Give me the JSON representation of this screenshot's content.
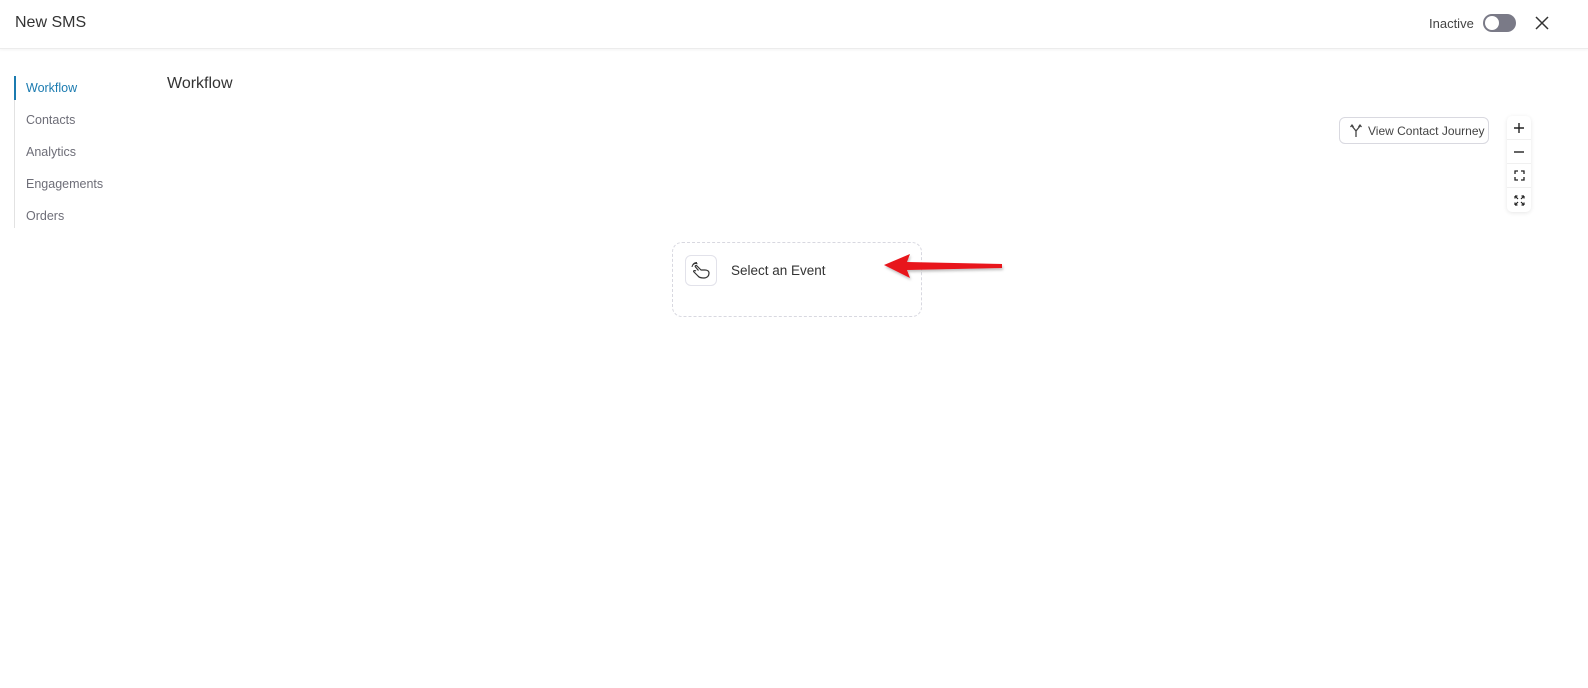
{
  "header": {
    "title": "New SMS",
    "status_label": "Inactive",
    "toggle_on": false,
    "toggle_color": "#7a7a87",
    "close_icon": "close-icon"
  },
  "sidebar": {
    "accent_color": "#1b7bb0",
    "items": [
      {
        "label": "Workflow",
        "active": true
      },
      {
        "label": "Contacts",
        "active": false
      },
      {
        "label": "Analytics",
        "active": false
      },
      {
        "label": "Engagements",
        "active": false
      },
      {
        "label": "Orders",
        "active": false
      }
    ]
  },
  "main": {
    "title": "Workflow",
    "journey_button": {
      "label": "View Contact Journey",
      "icon": "branch-icon"
    },
    "zoom_controls": [
      {
        "name": "zoom-in",
        "icon": "plus-icon"
      },
      {
        "name": "zoom-out",
        "icon": "minus-icon"
      },
      {
        "name": "fit-view",
        "icon": "fit-view-icon"
      },
      {
        "name": "fullscreen",
        "icon": "expand-icon"
      }
    ],
    "event_node": {
      "label": "Select an Event",
      "icon": "hand-pointer-icon"
    },
    "annotation": {
      "type": "arrow",
      "color": "#e8141b"
    }
  }
}
